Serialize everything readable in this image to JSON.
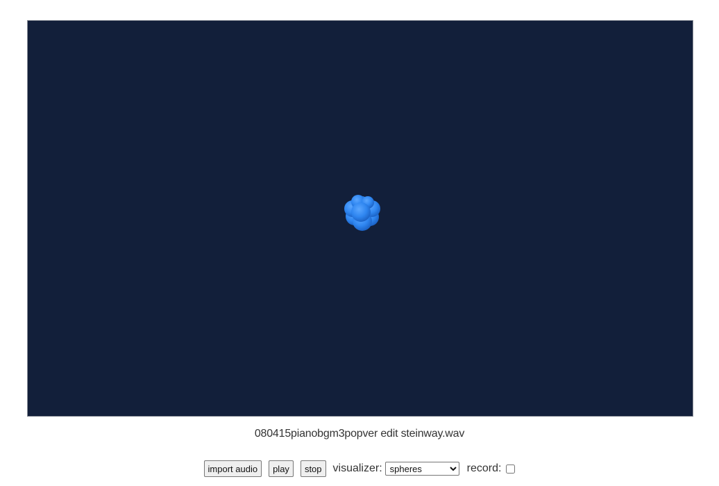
{
  "visualizer_canvas": {
    "background_color": "#121f3a",
    "sphere_color": "#2f86f0"
  },
  "track": {
    "filename": "080415pianobgm3popver edit steinway.wav"
  },
  "controls": {
    "import_label": "import audio",
    "play_label": "play",
    "stop_label": "stop",
    "visualizer_label": "visualizer:",
    "visualizer_selected": "spheres",
    "record_label": "record:",
    "record_checked": false
  }
}
